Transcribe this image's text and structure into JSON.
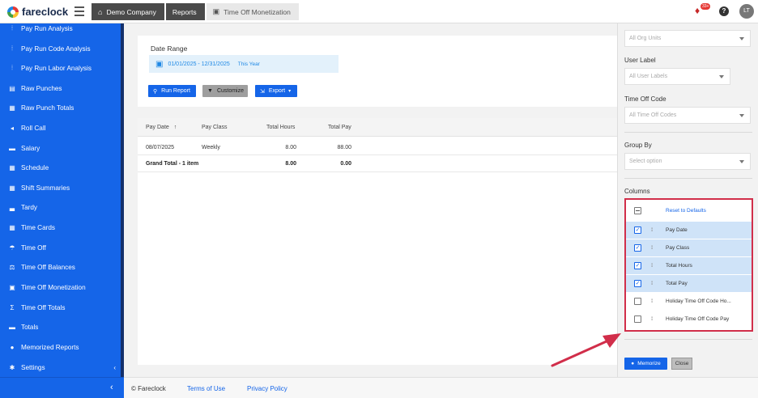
{
  "app": {
    "name": "fareclock"
  },
  "breadcrumb": [
    {
      "label": "Demo Company",
      "icon": "home-icon"
    },
    {
      "label": "Reports"
    },
    {
      "label": "Time Off Monetization",
      "icon": "money-icon"
    }
  ],
  "topbar": {
    "notification_count": "33+",
    "help": "?",
    "user_initials": "LT"
  },
  "sidebar": {
    "items": [
      {
        "label": "Pay Run Analysis",
        "icon": "chart-icon"
      },
      {
        "label": "Pay Run Code Analysis",
        "icon": "chart-icon"
      },
      {
        "label": "Pay Run Labor Analysis",
        "icon": "chart-icon"
      },
      {
        "label": "Raw Punches",
        "icon": "list-icon"
      },
      {
        "label": "Raw Punch Totals",
        "icon": "table-icon"
      },
      {
        "label": "Roll Call",
        "icon": "megaphone-icon"
      },
      {
        "label": "Salary",
        "icon": "money-icon"
      },
      {
        "label": "Schedule",
        "icon": "calendar-icon"
      },
      {
        "label": "Shift Summaries",
        "icon": "table-icon"
      },
      {
        "label": "Tardy",
        "icon": "bed-icon"
      },
      {
        "label": "Time Cards",
        "icon": "table-icon"
      },
      {
        "label": "Time Off",
        "icon": "umbrella-icon"
      },
      {
        "label": "Time Off Balances",
        "icon": "scale-icon"
      },
      {
        "label": "Time Off Monetization",
        "icon": "money-icon"
      },
      {
        "label": "Time Off Totals",
        "icon": "sum-icon"
      },
      {
        "label": "Totals",
        "icon": "money-icon"
      },
      {
        "label": "Memorized Reports",
        "icon": "lightbulb-icon"
      },
      {
        "label": "Settings",
        "icon": "gear-icon"
      }
    ]
  },
  "report": {
    "date_range_label": "Date Range",
    "date_range_value": "01/01/2025 - 12/31/2025",
    "date_range_preset": "This Year",
    "run_report": "Run Report",
    "customize": "Customize",
    "export": "Export"
  },
  "table": {
    "headers": [
      "Pay Date",
      "Pay Class",
      "Total Hours",
      "Total Pay"
    ],
    "sort_indicator": "↑",
    "rows": [
      [
        "08/07/2025",
        "Weekly",
        "8.00",
        "88.00"
      ]
    ],
    "total_row": [
      "Grand Total - 1 item",
      "",
      "8.00",
      "0.00"
    ]
  },
  "panel": {
    "org_units_placeholder": "All Org Units",
    "user_label_title": "User Label",
    "user_label_placeholder": "All User Labels",
    "time_off_code_title": "Time Off Code",
    "time_off_code_placeholder": "All Time Off Codes",
    "group_by_title": "Group By",
    "group_by_placeholder": "Select option",
    "columns_title": "Columns",
    "reset_defaults": "Reset to Defaults",
    "columns": [
      {
        "label": "Pay Date",
        "checked": true
      },
      {
        "label": "Pay Class",
        "checked": true
      },
      {
        "label": "Total Hours",
        "checked": true
      },
      {
        "label": "Total Pay",
        "checked": true
      },
      {
        "label": "Holiday Time Off Code Ho...",
        "checked": false
      },
      {
        "label": "Holiday Time Off Code Pay",
        "checked": false
      }
    ],
    "memorize": "Memorize",
    "close": "Close"
  },
  "footer": {
    "copyright": "© Fareclock",
    "terms": "Terms of Use",
    "privacy": "Privacy Policy"
  },
  "colors": {
    "brand_blue": "#1565e8",
    "highlight": "#d12e4a"
  }
}
